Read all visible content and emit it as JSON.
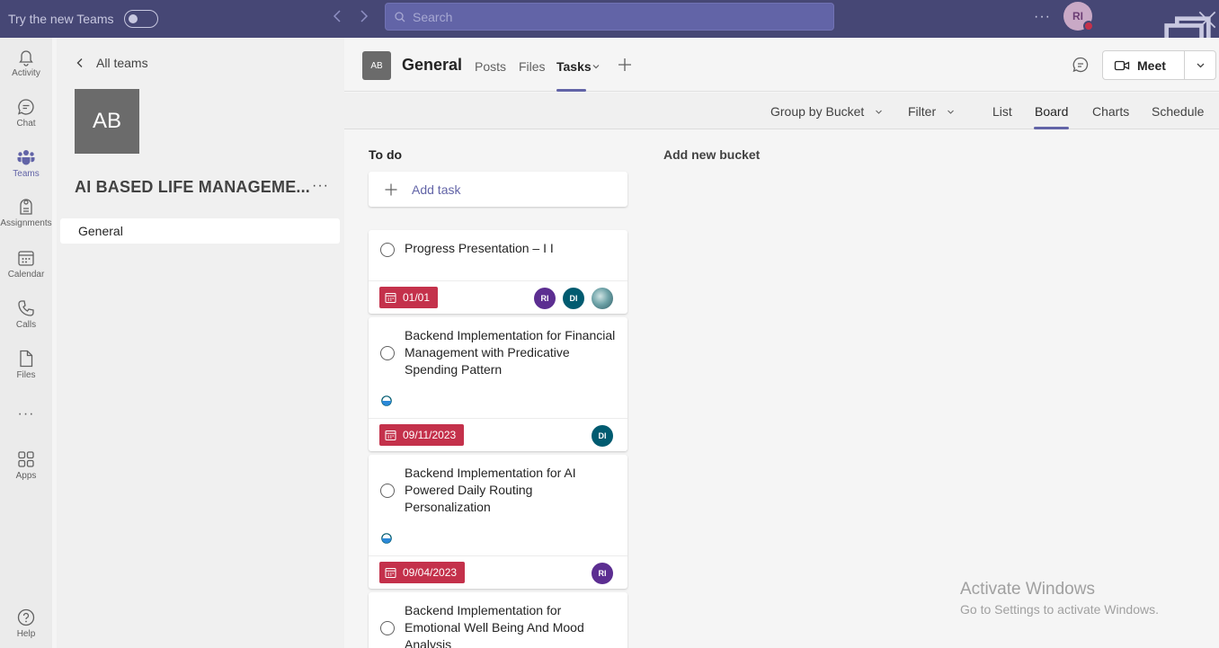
{
  "titlebar": {
    "try_new_teams": "Try the new Teams",
    "search_placeholder": "Search",
    "more": "···",
    "avatar_initials": "RI"
  },
  "rail": {
    "activity": "Activity",
    "chat": "Chat",
    "teams": "Teams",
    "assignments": "Assignments",
    "calendar": "Calendar",
    "calls": "Calls",
    "files": "Files",
    "more": "···",
    "apps": "Apps",
    "help": "Help"
  },
  "teampane": {
    "all_teams": "All teams",
    "team_initials": "AB",
    "team_name": "AI BASED LIFE MANAGEME...",
    "more": "···",
    "channels": [
      {
        "label": "General"
      }
    ]
  },
  "header": {
    "avatar_initials": "AB",
    "channel_title": "General",
    "tabs": [
      {
        "label": "Posts"
      },
      {
        "label": "Files"
      },
      {
        "label": "Tasks"
      }
    ],
    "meet_label": "Meet"
  },
  "toolbar": {
    "group_by": "Group by Bucket",
    "filter": "Filter",
    "views": [
      {
        "label": "List"
      },
      {
        "label": "Board"
      },
      {
        "label": "Charts"
      },
      {
        "label": "Schedule"
      }
    ]
  },
  "board": {
    "bucket_title": "To do",
    "add_task": "Add task",
    "add_new_bucket": "Add new bucket",
    "tasks": [
      {
        "title": "Progress Presentation – I I",
        "due": "01/01",
        "assignees": [
          "RI",
          "DI",
          ""
        ]
      },
      {
        "title": "Backend Implementation for Financial Management with Predicative Spending Pattern",
        "progress": "in progress",
        "due": "09/11/2023",
        "assignees": [
          "DI"
        ]
      },
      {
        "title": "Backend Implementation for AI Powered Daily Routing Personalization",
        "progress": "in progress",
        "due": "09/04/2023",
        "assignees": [
          "RI"
        ]
      },
      {
        "title": "Backend Implementation for Emotional Well Being And Mood Analysis"
      }
    ]
  },
  "watermark": {
    "line1": "Activate Windows",
    "line2": "Go to Settings to activate Windows."
  },
  "colors": {
    "titlebar": "#464775",
    "accent": "#6264a7",
    "due_overdue": "#c4314b",
    "assignee_ri": "#5c2e91",
    "assignee_di": "#005b70"
  }
}
